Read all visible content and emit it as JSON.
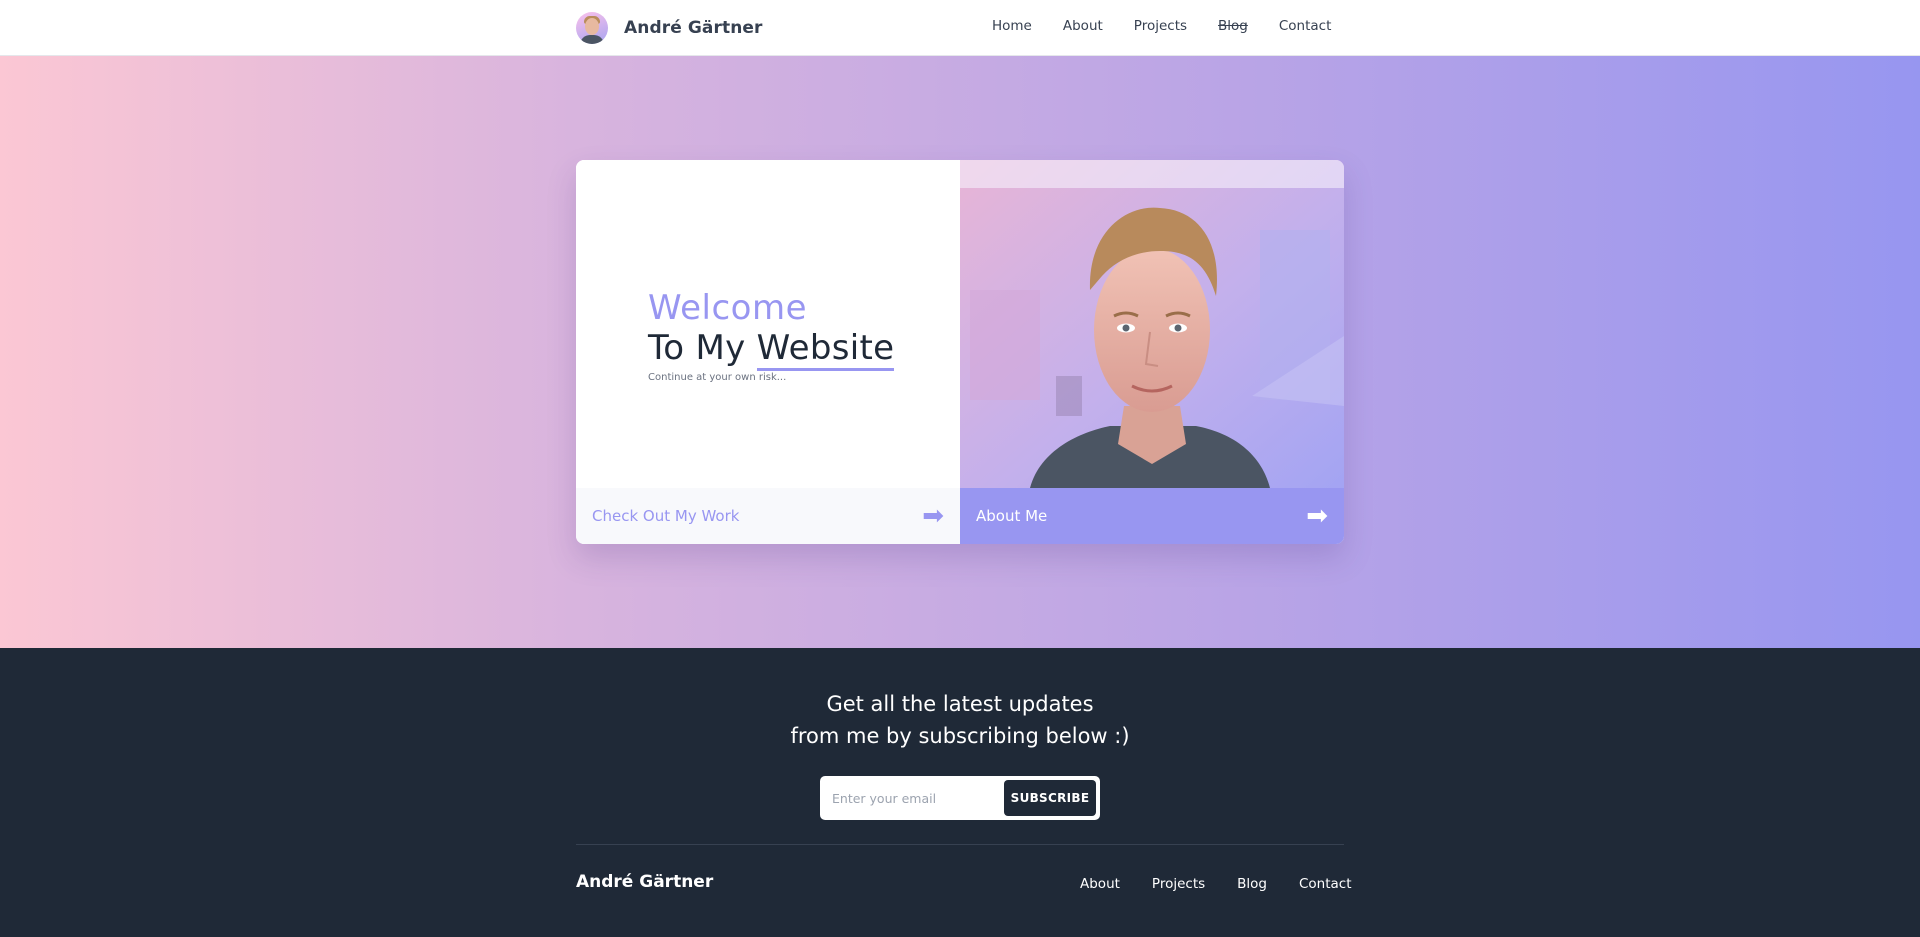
{
  "header": {
    "brand": "André Gärtner",
    "nav": [
      "Home",
      "About",
      "Projects",
      "Blog",
      "Contact"
    ]
  },
  "hero": {
    "welcome": "Welcome",
    "title_prefix": "To My ",
    "title_highlight": "Website",
    "tagline": "Continue at your own risk...",
    "work_button": "Check Out My Work",
    "about_button": "About Me"
  },
  "footer": {
    "headline_line1": "Get all the latest updates",
    "headline_line2": "from me by subscribing below :)",
    "email_placeholder": "Enter your email",
    "subscribe_label": "SUBSCRIBE",
    "brand": "André Gärtner",
    "nav": [
      "About",
      "Projects",
      "Blog",
      "Contact"
    ]
  },
  "colors": {
    "accent": "#9896f1",
    "dark": "#1f2937",
    "hero_gradient_start": "#fbc7d4",
    "hero_gradient_end": "#9796f0"
  },
  "icons": {
    "arrow": "arrow-right-icon",
    "avatar": "avatar"
  }
}
